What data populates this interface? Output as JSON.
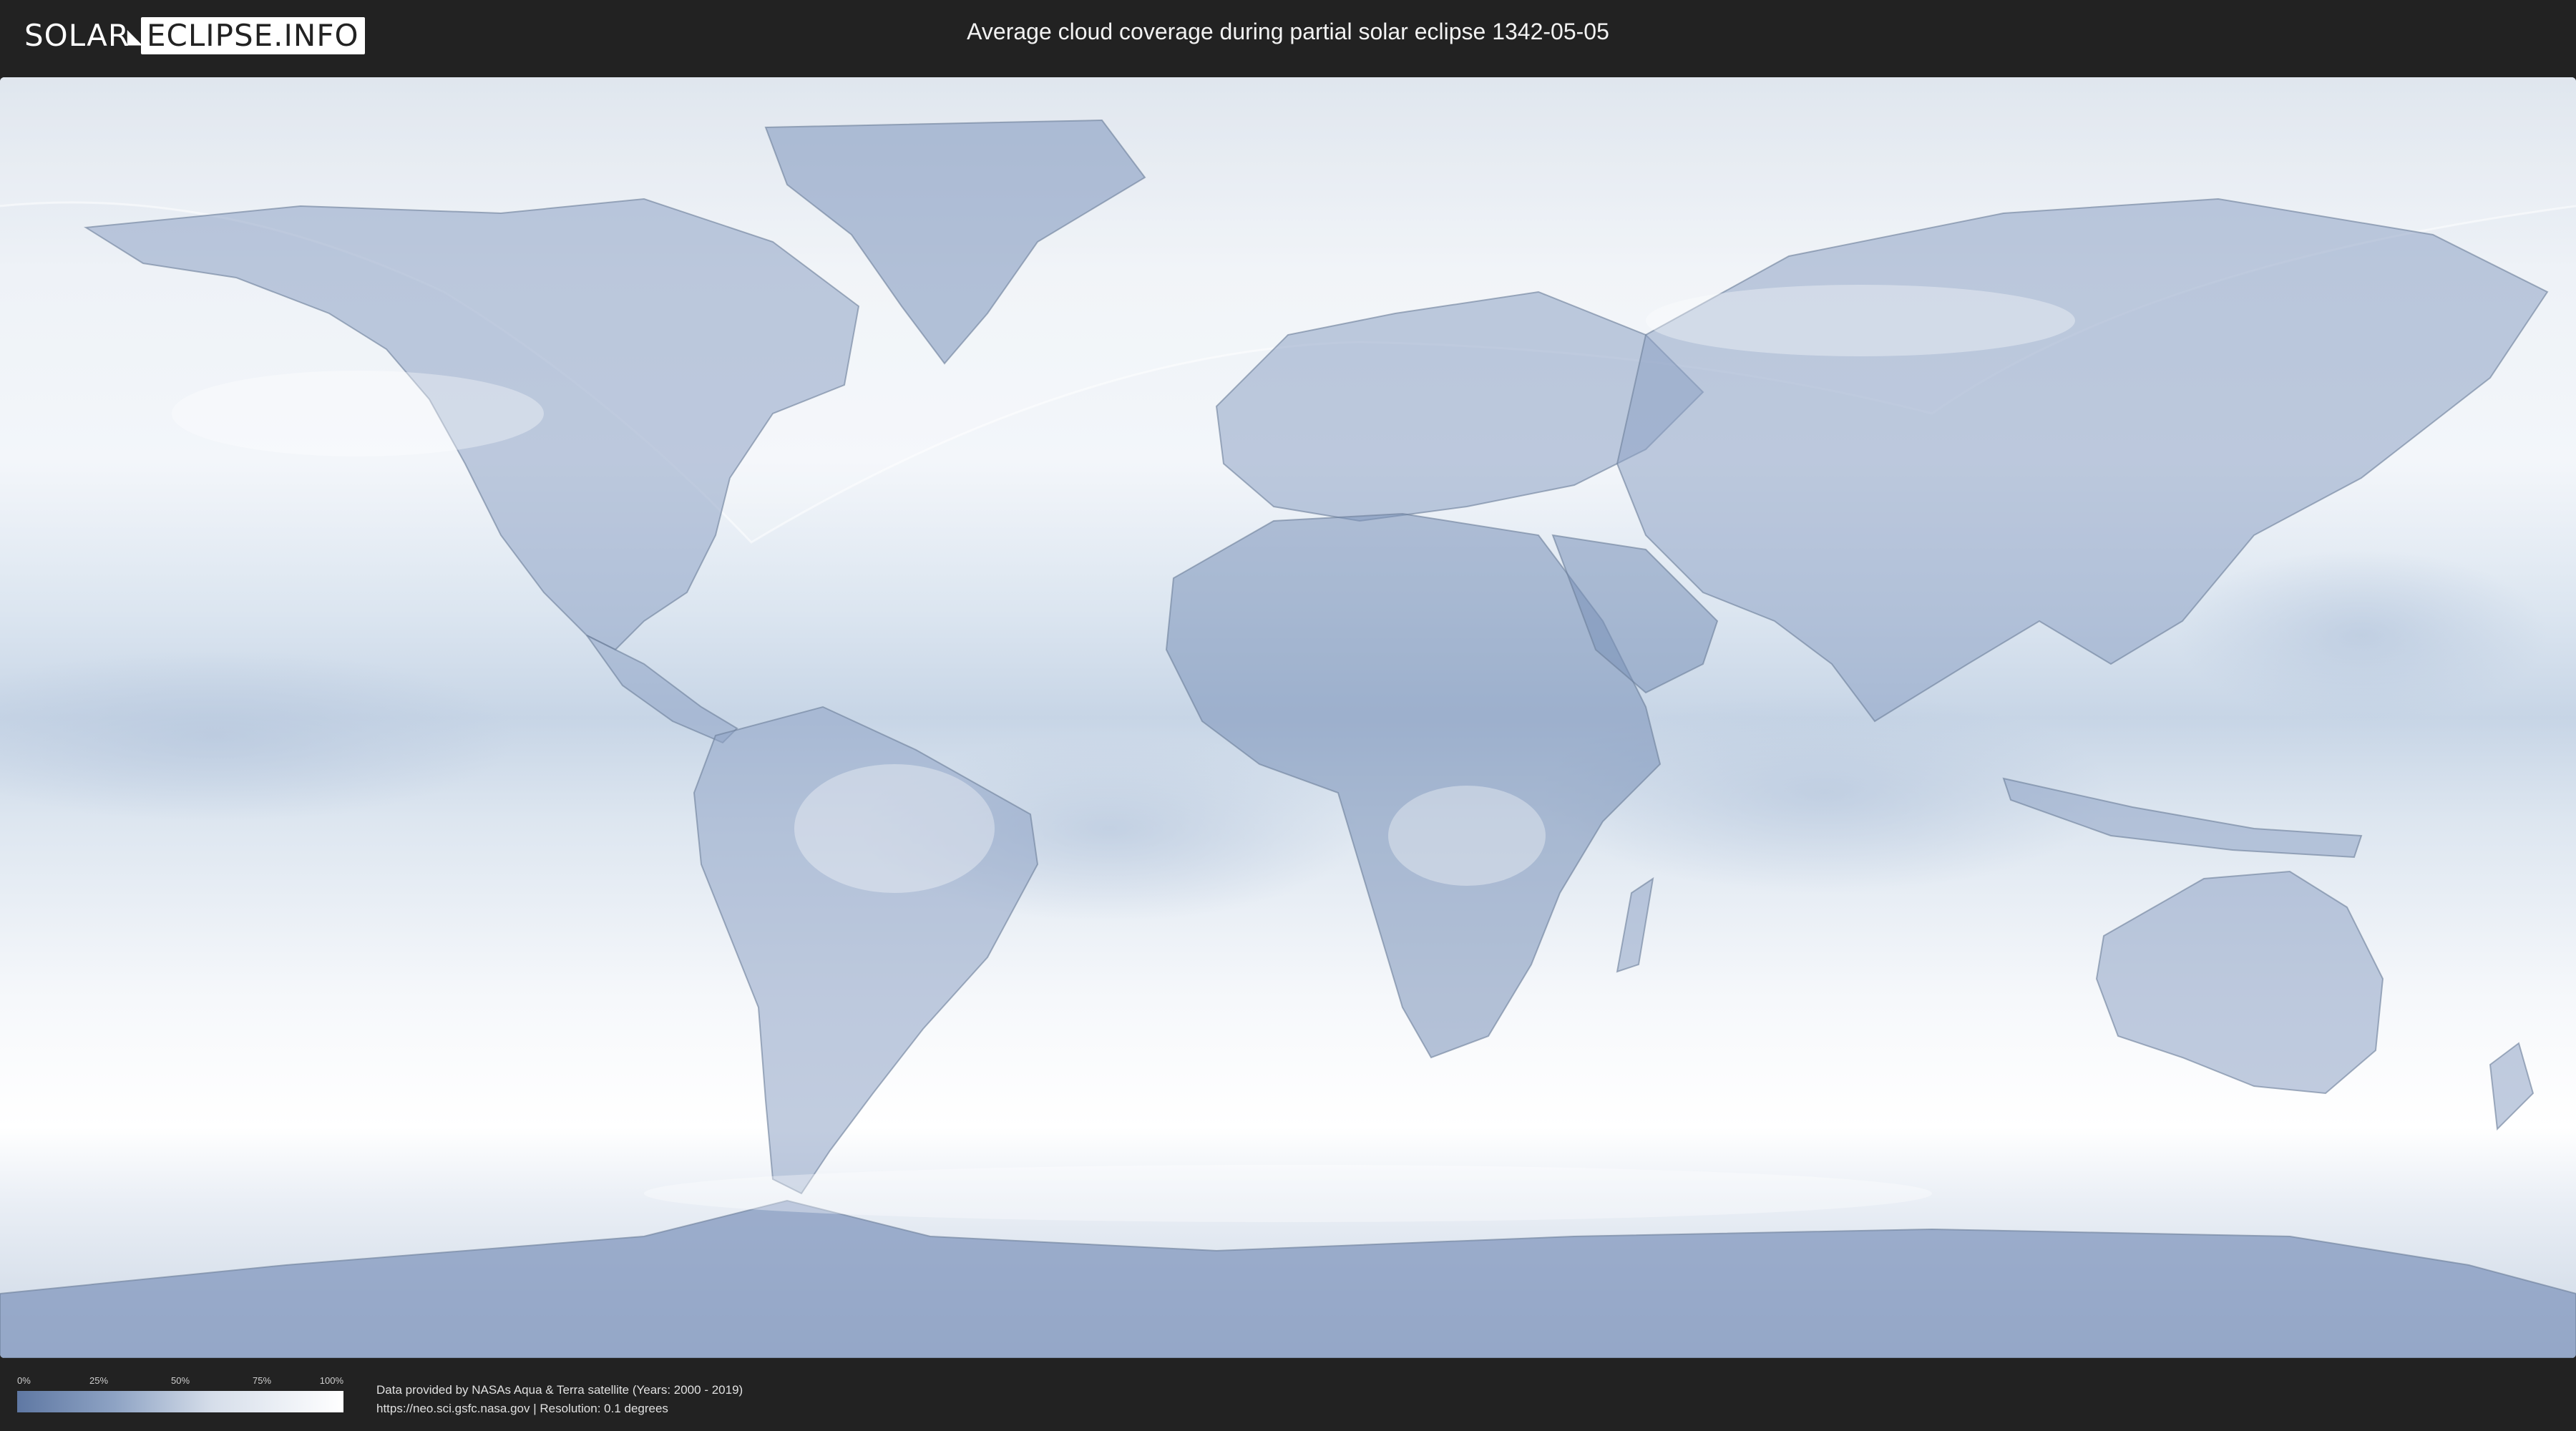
{
  "header": {
    "logo": {
      "part1": "SOLAR",
      "part2": "ECLIPSE.INFO"
    },
    "title": "Average cloud coverage during partial solar eclipse 1342-05-05"
  },
  "legend": {
    "ticks": [
      "0%",
      "25%",
      "50%",
      "75%",
      "100%"
    ],
    "colors": {
      "min": "#5f78a3",
      "max": "#ffffff"
    }
  },
  "credits": {
    "line1": "Data provided by NASAs Aqua & Terra satellite (Years: 2000 - 2019)",
    "line2": "https://neo.sci.gsfc.nasa.gov | Resolution: 0.1 degrees"
  },
  "colors": {
    "background": "#222222",
    "ocean_cloud": "#e8eef6",
    "land_clear": "#7890b8",
    "eclipse_zone": "#f4f6f8"
  }
}
